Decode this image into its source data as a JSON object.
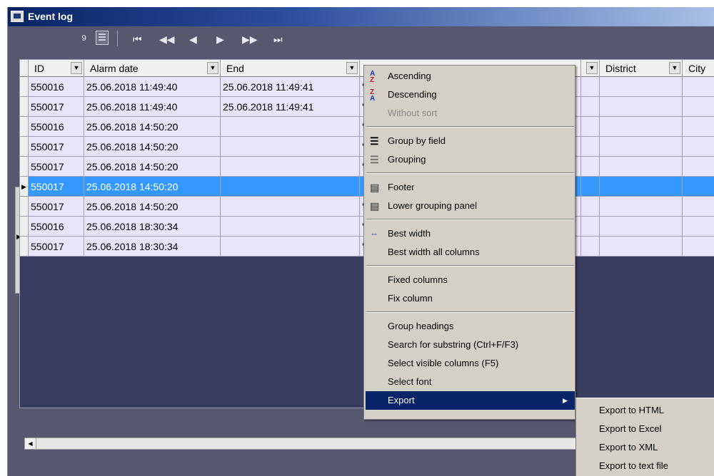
{
  "window": {
    "title": "Event log"
  },
  "navigator": {
    "record_count": "9",
    "buttons": [
      {
        "name": "first-record",
        "glyph": "⏮"
      },
      {
        "name": "prev-page",
        "glyph": "◀◀"
      },
      {
        "name": "prev-record",
        "glyph": "◀"
      },
      {
        "name": "next-record",
        "glyph": "▶"
      },
      {
        "name": "next-page",
        "glyph": "▶▶"
      },
      {
        "name": "last-record",
        "glyph": "⏭"
      }
    ]
  },
  "grid": {
    "columns": [
      {
        "label": "ID"
      },
      {
        "label": "Alarm date"
      },
      {
        "label": "End"
      },
      {
        "label": ""
      },
      {
        "label": ""
      },
      {
        "label": "District"
      },
      {
        "label": "City"
      }
    ],
    "rows": [
      {
        "id": "550016",
        "alarm_date": "25.06.2018 11:49:40",
        "end": "25.06.2018 11:49:41",
        "col4": "'"
      },
      {
        "id": "550017",
        "alarm_date": "25.06.2018 11:49:40",
        "end": "25.06.2018 11:49:41",
        "col4": "'"
      },
      {
        "id": "550016",
        "alarm_date": "25.06.2018 14:50:20",
        "end": "",
        "col4": "'"
      },
      {
        "id": "550017",
        "alarm_date": "25.06.2018 14:50:20",
        "end": "",
        "col4": "'"
      },
      {
        "id": "550017",
        "alarm_date": "25.06.2018 14:50:20",
        "end": "",
        "col4": "'"
      },
      {
        "id": "550017",
        "alarm_date": "25.06.2018 14:50:20",
        "end": "",
        "col4": "",
        "selected": true
      },
      {
        "id": "550017",
        "alarm_date": "25.06.2018 14:50:20",
        "end": "",
        "col4": "'"
      },
      {
        "id": "550016",
        "alarm_date": "25.06.2018 18:30:34",
        "end": "",
        "col4": "'"
      },
      {
        "id": "550017",
        "alarm_date": "25.06.2018 18:30:34",
        "end": "",
        "col4": "'"
      }
    ],
    "selected_row_indicator": "▶"
  },
  "context_menu": {
    "items": [
      {
        "label": "Ascending",
        "icon": "sort-ascending-icon"
      },
      {
        "label": "Descending",
        "icon": "sort-descending-icon"
      },
      {
        "label": "Without sort",
        "disabled": true
      },
      {
        "separator": true
      },
      {
        "label": "Group by field",
        "icon": "group-by-field-icon"
      },
      {
        "label": "Grouping",
        "icon": "grouping-icon"
      },
      {
        "separator": true
      },
      {
        "label": "Footer",
        "icon": "footer-icon"
      },
      {
        "label": "Lower grouping panel",
        "icon": "lower-grouping-panel-icon"
      },
      {
        "separator": true
      },
      {
        "label": "Best width",
        "icon": "best-width-icon"
      },
      {
        "label": "Best width all columns"
      },
      {
        "separator": true
      },
      {
        "label": "Fixed columns"
      },
      {
        "label": "Fix column"
      },
      {
        "separator": true
      },
      {
        "label": "Group headings"
      },
      {
        "label": "Search for substring (Ctrl+F/F3)"
      },
      {
        "label": "Select visible columns (F5)"
      },
      {
        "label": "Select font"
      },
      {
        "label": "Export",
        "submenu": true,
        "active": true
      }
    ]
  },
  "export_submenu": {
    "items": [
      {
        "label": "Export to HTML"
      },
      {
        "label": "Export to Excel"
      },
      {
        "label": "Export to XML"
      },
      {
        "label": "Export to text file"
      }
    ]
  },
  "colors": {
    "title_gradient_start": "#0a2466",
    "background": "#575770",
    "grid_empty": "#3b3d60",
    "row_bg": "#e8e5fb",
    "selection": "#3399ff",
    "menu_bg": "#d4d0c8",
    "menu_active": "#0a246a"
  }
}
